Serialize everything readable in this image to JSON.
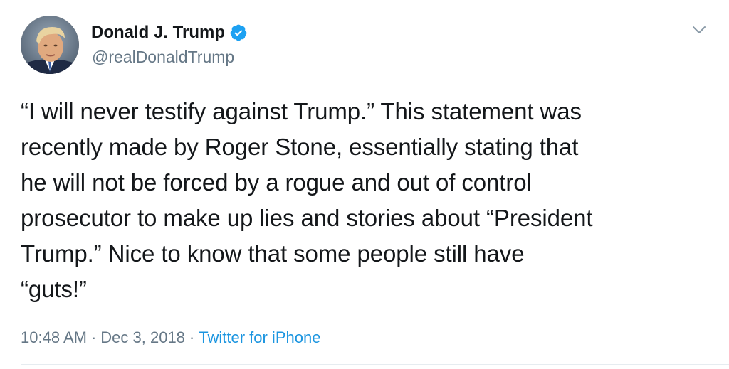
{
  "tweet": {
    "display_name": "Donald J. Trump",
    "handle": "@realDonaldTrump",
    "text": "“I will never testify against Trump.” This statement was\nrecently made by Roger Stone, essentially stating that\nhe will not be forced by a rogue and out of control\nprosecutor to make up lies and stories about “President\nTrump.” Nice to know that some people still have\n“guts!”",
    "time": "10:48 AM",
    "date": "Dec 3, 2018",
    "source": "Twitter for iPhone",
    "separator": "·"
  },
  "icons": {
    "verified": "verified-badge-icon",
    "menu": "chevron-down-icon",
    "avatar": "profile-photo"
  },
  "colors": {
    "text": "#14171a",
    "secondary": "#657786",
    "link": "#1b95e0",
    "verified": "#1da1f2",
    "divider": "#e6ecf0"
  }
}
